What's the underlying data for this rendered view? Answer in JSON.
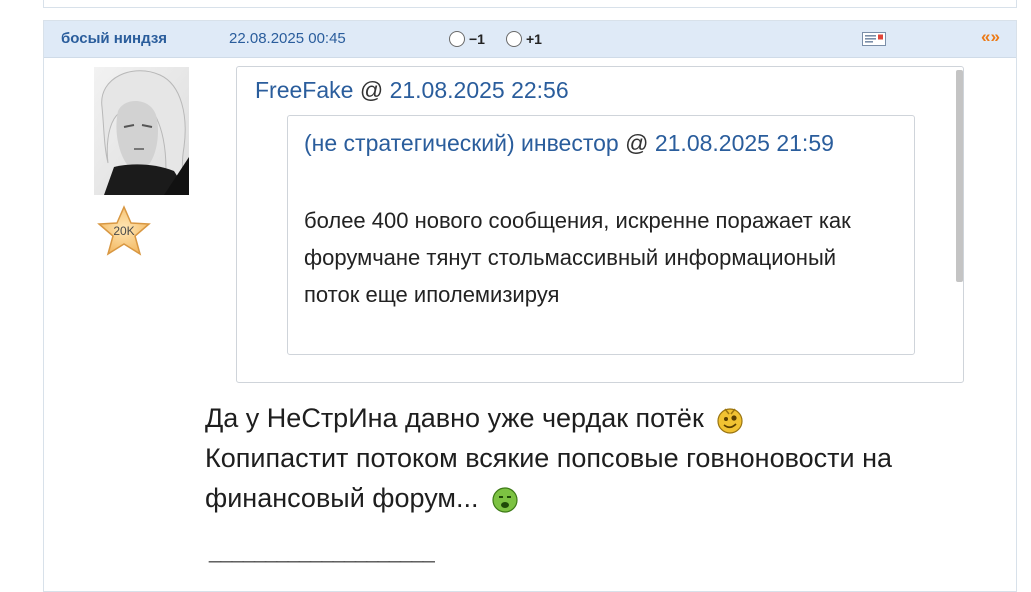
{
  "post": {
    "author": "босый ниндзя",
    "date": "22.08.2025 00:45",
    "vote_minus": "−1",
    "vote_plus": "+1",
    "quote_link": "«»",
    "rank_badge": "20K",
    "icons": {
      "mail": "mail-icon",
      "rank": "star-icon"
    },
    "colors": {
      "header_bg": "#dfeaf7",
      "link": "#2a5d9c",
      "accent": "#ec7a16"
    }
  },
  "quote": {
    "author": "FreeFake",
    "separator": " @ ",
    "date": "21.08.2025 22:56",
    "inner": {
      "author": "(не стратегический) инвестор",
      "separator": " @ ",
      "date": "21.08.2025 21:59",
      "text": "более 400 нового сообщения, искренне поражает как форумчане тянут стольмассивный информационый поток еще иполемизируя"
    }
  },
  "reply": {
    "line1": "Да у НеСтрИна давно уже чердак потёк",
    "line2": "Копипастит потоком всякие попсовые говноновости на финансовый форум...",
    "smiley1": "crazy-smiley-icon",
    "smiley2": "sick-smiley-icon"
  },
  "signature": {
    "rule": "____________________"
  }
}
